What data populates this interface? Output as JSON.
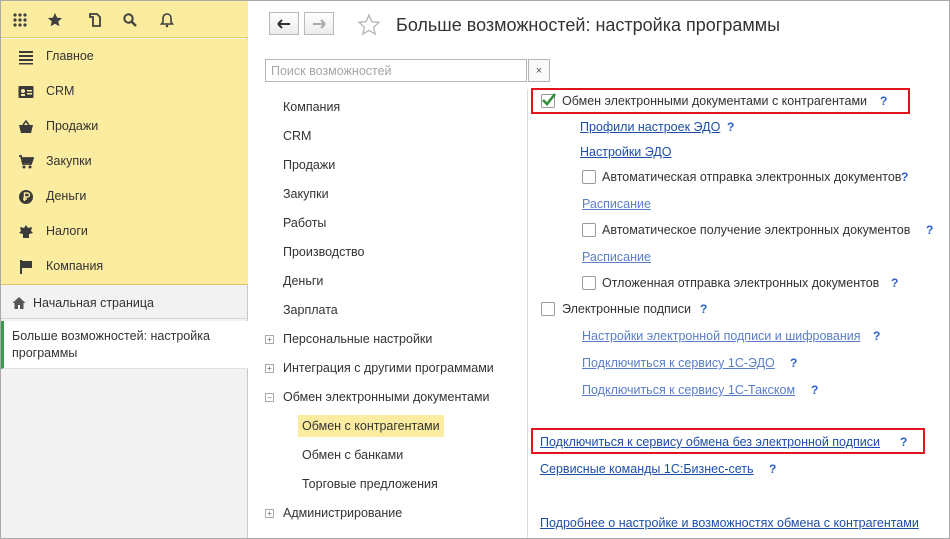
{
  "colors": {
    "accent_yellow": "#fbeca0",
    "link": "#1c4ea8",
    "highlight_red": "#e0141a",
    "active_tab_bar": "#3a9c4c"
  },
  "topbar": {
    "icons": [
      "apps-grid-icon",
      "favorites-star-icon",
      "history-icon",
      "search-icon",
      "notifications-bell-icon"
    ]
  },
  "sidebar": {
    "sections": [
      {
        "label": "Главное",
        "icon": "main-menu-icon"
      },
      {
        "label": "CRM",
        "icon": "crm-card-icon"
      },
      {
        "label": "Продажи",
        "icon": "sales-basket-icon"
      },
      {
        "label": "Закупки",
        "icon": "purchases-cart-icon"
      },
      {
        "label": "Деньги",
        "icon": "money-coin-icon"
      },
      {
        "label": "Налоги",
        "icon": "taxes-emblem-icon"
      },
      {
        "label": "Компания",
        "icon": "company-flag-icon"
      }
    ],
    "home": "Начальная страница",
    "open_tab": "Больше возможностей: настройка программы"
  },
  "header": {
    "title": "Больше возможностей: настройка программы"
  },
  "search": {
    "placeholder": "Поиск возможностей",
    "value": "",
    "clear_label": "×"
  },
  "tree": [
    {
      "label": "Компания"
    },
    {
      "label": "CRM"
    },
    {
      "label": "Продажи"
    },
    {
      "label": "Закупки"
    },
    {
      "label": "Работы"
    },
    {
      "label": "Производство"
    },
    {
      "label": "Деньги"
    },
    {
      "label": "Зарплата"
    },
    {
      "label": "Персональные настройки",
      "expander": "+"
    },
    {
      "label": "Интеграция с другими программами",
      "expander": "+"
    },
    {
      "label": "Обмен электронными документами",
      "expander": "−"
    },
    {
      "label": "Обмен с контрагентами",
      "selected": true
    },
    {
      "label": "Обмен с банками"
    },
    {
      "label": "Торговые предложения"
    },
    {
      "label": "Администрирование",
      "expander": "+"
    }
  ],
  "options": {
    "edo_exchange": {
      "label": "Обмен электронными документами с контрагентами",
      "checked": true
    },
    "edo_profiles": "Профили настроек ЭДО",
    "edo_settings": "Настройки ЭДО",
    "auto_send": {
      "label": "Автоматическая отправка электронных документов",
      "checked": false
    },
    "schedule_1": "Расписание",
    "auto_receive": {
      "label": "Автоматическое получение электронных документов",
      "checked": false
    },
    "schedule_2": "Расписание",
    "deferred_send": {
      "label": "Отложенная отправка электронных документов",
      "checked": false
    },
    "e_signatures": {
      "label": "Электронные подписи",
      "checked": false
    },
    "sig_settings": "Настройки электронной подписи и шифрования",
    "connect_1c_edo": "Подключиться к сервису 1С-ЭДО",
    "connect_1c_taxcom": "Подключиться к сервису 1С-Такском",
    "connect_no_sig": "Подключиться к сервису обмена без электронной подписи",
    "service_commands": "Сервисные команды 1С:Бизнес-сеть",
    "more_info": "Подробнее о настройке и возможностях обмена с контрагентами",
    "help_mark": "?"
  }
}
